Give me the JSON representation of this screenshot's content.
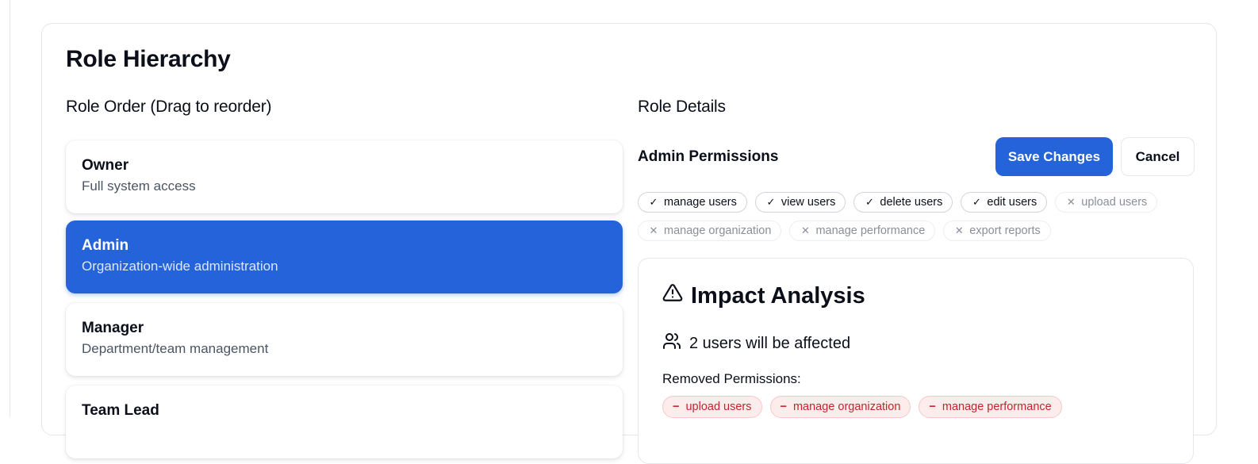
{
  "card": {
    "title": "Role Hierarchy"
  },
  "left": {
    "section_title": "Role Order (Drag to reorder)",
    "roles": [
      {
        "name": "Owner",
        "description": "Full system access",
        "selected": false
      },
      {
        "name": "Admin",
        "description": "Organization-wide administration",
        "selected": true
      },
      {
        "name": "Manager",
        "description": "Department/team management",
        "selected": false
      },
      {
        "name": "Team Lead",
        "description": "",
        "selected": false
      }
    ]
  },
  "right": {
    "section_title": "Role Details",
    "permissions_title": "Admin Permissions",
    "save_label": "Save Changes",
    "cancel_label": "Cancel",
    "permissions": [
      {
        "label": "manage users",
        "enabled": true,
        "icon": "check-icon"
      },
      {
        "label": "view users",
        "enabled": true,
        "icon": "check-icon"
      },
      {
        "label": "delete users",
        "enabled": true,
        "icon": "check-icon"
      },
      {
        "label": "edit users",
        "enabled": true,
        "icon": "check-icon"
      },
      {
        "label": "upload users",
        "enabled": false,
        "icon": "x-icon"
      },
      {
        "label": "manage organization",
        "enabled": false,
        "icon": "x-icon"
      },
      {
        "label": "manage performance",
        "enabled": false,
        "icon": "x-icon"
      },
      {
        "label": "export reports",
        "enabled": false,
        "icon": "x-icon"
      }
    ],
    "impact": {
      "title": "Impact Analysis",
      "title_icon": "warning-triangle-icon",
      "users_text": "2 users will be affected",
      "users_icon": "users-icon",
      "removed_label": "Removed Permissions:",
      "removed": [
        "upload users",
        "manage organization",
        "manage performance"
      ]
    }
  },
  "colors": {
    "accent": "#2563db",
    "danger": "#c0262d",
    "danger_bg": "#fdecec"
  }
}
